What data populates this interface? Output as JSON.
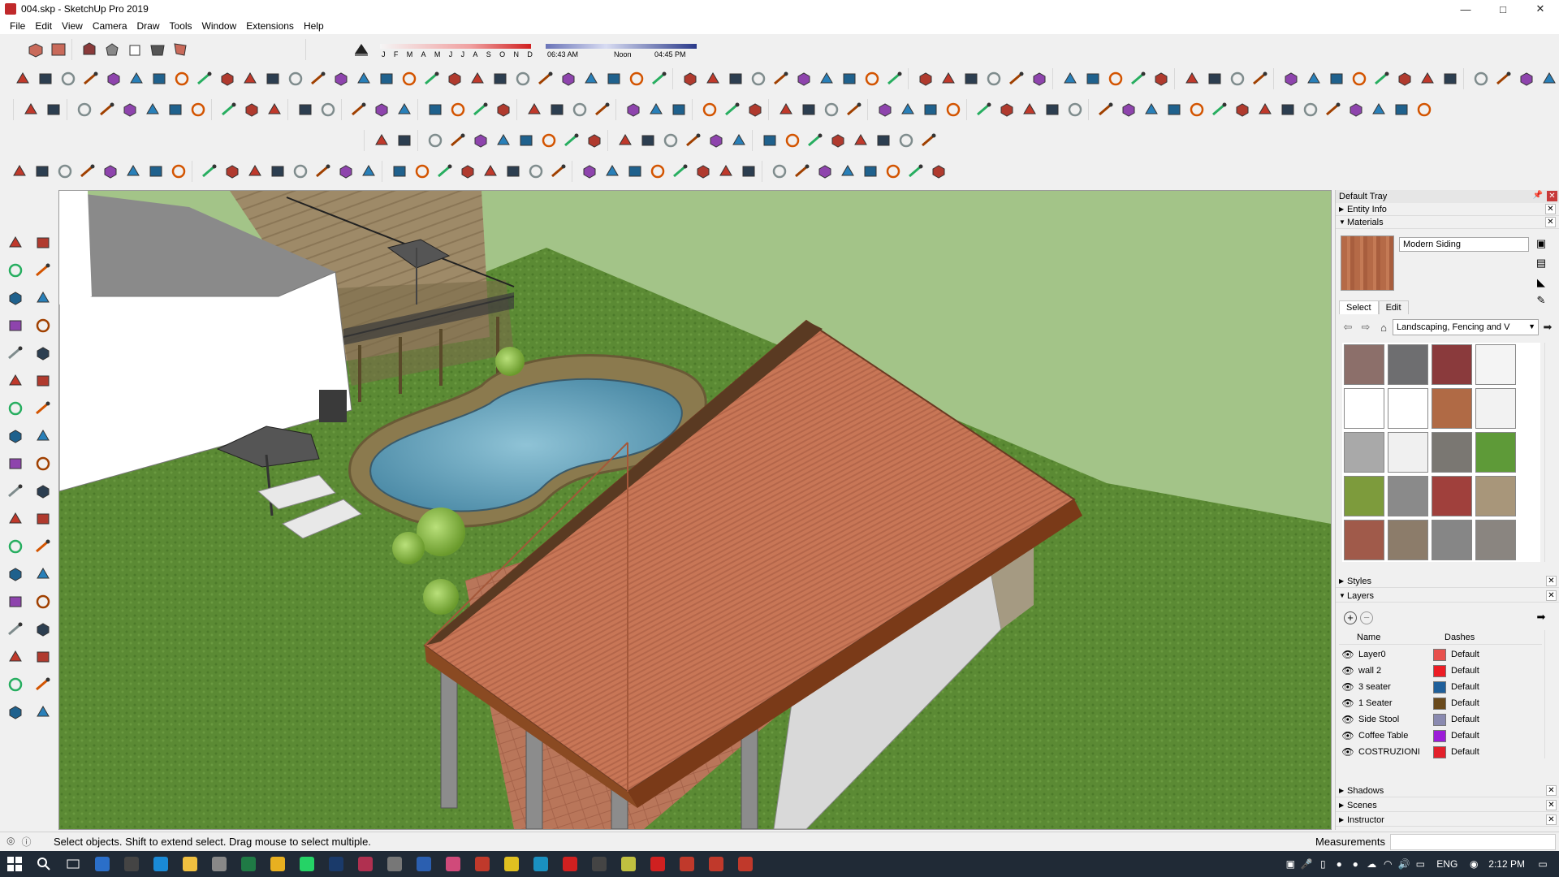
{
  "window": {
    "title": "004.skp - SketchUp Pro 2019",
    "controls": [
      "minimize",
      "maximize",
      "close"
    ]
  },
  "menu": [
    "File",
    "Edit",
    "View",
    "Camera",
    "Draw",
    "Tools",
    "Window",
    "Extensions",
    "Help"
  ],
  "shadow_settings": {
    "months": [
      "J",
      "F",
      "M",
      "A",
      "M",
      "J",
      "J",
      "A",
      "S",
      "O",
      "N",
      "D"
    ],
    "time_start": "06:43 AM",
    "time_mid": "Noon",
    "time_end": "04:45 PM"
  },
  "tray": {
    "title": "Default Tray",
    "panels": {
      "entity_info": "Entity Info",
      "materials": "Materials",
      "styles": "Styles",
      "layers": "Layers",
      "shadows": "Shadows",
      "scenes": "Scenes",
      "instructor": "Instructor"
    },
    "materials": {
      "current_name": "Modern Siding",
      "tab_select": "Select",
      "tab_edit": "Edit",
      "library": "Landscaping, Fencing and V",
      "swatch_colors": [
        "#8c6f6a",
        "#6e6e70",
        "#8a3a3c",
        "#f4f4f4",
        "#ffffff",
        "#ffffff",
        "#b06a45",
        "#f2f2f2",
        "#a9a9a9",
        "#f0f0f0",
        "#7a7772",
        "#5e9a38",
        "#7d9b3c",
        "#8a8a8a",
        "#a0403c",
        "#a8967a",
        "#a05a4a",
        "#8c7c6a",
        "#868686",
        "#8a8580"
      ]
    },
    "layers": {
      "col_name": "Name",
      "col_dashes": "Dashes",
      "rows": [
        {
          "name": "Layer0",
          "color": "#e8504c",
          "dashes": "Default"
        },
        {
          "name": "wall 2",
          "color": "#ec1c24",
          "dashes": "Default"
        },
        {
          "name": "3 seater",
          "color": "#1f5f9a",
          "dashes": "Default"
        },
        {
          "name": "1 Seater",
          "color": "#6a4a1c",
          "dashes": "Default"
        },
        {
          "name": "Side Stool",
          "color": "#8a8ab0",
          "dashes": "Default"
        },
        {
          "name": "Coffee Table",
          "color": "#9c1cd8",
          "dashes": "Default"
        },
        {
          "name": "COSTRUZIONI",
          "color": "#e3202a",
          "dashes": "Default"
        }
      ]
    }
  },
  "status": {
    "message": "Select objects. Shift to extend select. Drag mouse to select multiple.",
    "measurements_label": "Measurements"
  },
  "taskbar": {
    "language": "ENG",
    "clock": "2:12 PM"
  }
}
